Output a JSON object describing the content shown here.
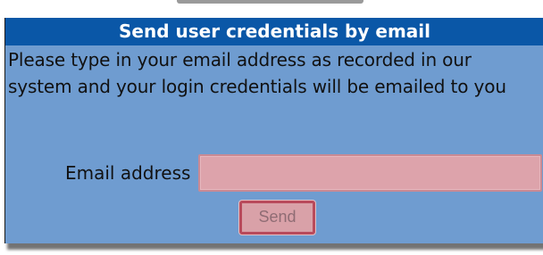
{
  "dialog": {
    "title": "Send user credentials by email",
    "instructions": "Please type in your email address as recorded in our system and your login credentials will be emailed to you",
    "email_label": "Email address",
    "email_value": "",
    "send_label": "Send"
  }
}
